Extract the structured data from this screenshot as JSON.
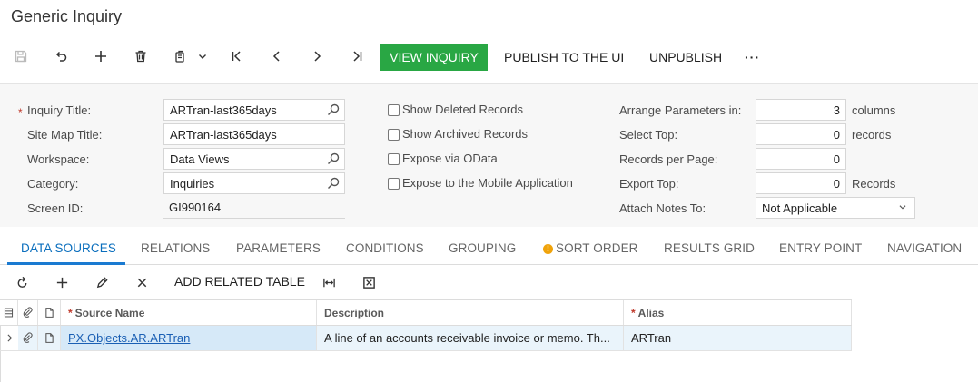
{
  "page_title": "Generic Inquiry",
  "toolbar": {
    "icons": [
      "save-icon",
      "undo-icon",
      "add-icon",
      "delete-icon",
      "copy-paste-icon",
      "chevron-down-icon",
      "first-record-icon",
      "previous-icon",
      "next-icon",
      "last-record-icon"
    ],
    "view_inquiry": "VIEW INQUIRY",
    "publish": "PUBLISH TO THE UI",
    "unpublish": "UNPUBLISH",
    "more": "···",
    "accent_color": "#29a744"
  },
  "form": {
    "inquiry_title_label": "Inquiry Title:",
    "inquiry_title_value": "ARTran-last365days",
    "site_map_title_label": "Site Map Title:",
    "site_map_title_value": "ARTran-last365days",
    "workspace_label": "Workspace:",
    "workspace_value": "Data Views",
    "category_label": "Category:",
    "category_value": "Inquiries",
    "screen_id_label": "Screen ID:",
    "screen_id_value": "GI990164",
    "show_deleted": "Show Deleted Records",
    "show_archived": "Show Archived Records",
    "expose_odata": "Expose via OData",
    "expose_mobile": "Expose to the Mobile Application",
    "arrange_label": "Arrange Parameters in:",
    "arrange_value": "3",
    "arrange_unit": "columns",
    "select_top_label": "Select Top:",
    "select_top_value": "0",
    "select_top_unit": "records",
    "records_per_page_label": "Records per Page:",
    "records_per_page_value": "0",
    "export_top_label": "Export Top:",
    "export_top_value": "0",
    "export_top_unit": "Records",
    "attach_notes_label": "Attach Notes To:",
    "attach_notes_value": "Not Applicable",
    "required_mark": "*"
  },
  "tabs": [
    {
      "label": "DATA SOURCES",
      "active": true
    },
    {
      "label": "RELATIONS"
    },
    {
      "label": "PARAMETERS"
    },
    {
      "label": "CONDITIONS"
    },
    {
      "label": "GROUPING"
    },
    {
      "label": "SORT ORDER",
      "warning": "!"
    },
    {
      "label": "RESULTS GRID"
    },
    {
      "label": "ENTRY POINT"
    },
    {
      "label": "NAVIGATION"
    }
  ],
  "grid_toolbar": {
    "add_related_table": "ADD RELATED TABLE"
  },
  "grid": {
    "headers": {
      "source_name": "Source Name",
      "description": "Description",
      "alias": "Alias"
    },
    "rows": [
      {
        "source_name": "PX.Objects.AR.ARTran",
        "description": "A line of an accounts receivable invoice or memo. Th...",
        "alias": "ARTran"
      }
    ]
  }
}
